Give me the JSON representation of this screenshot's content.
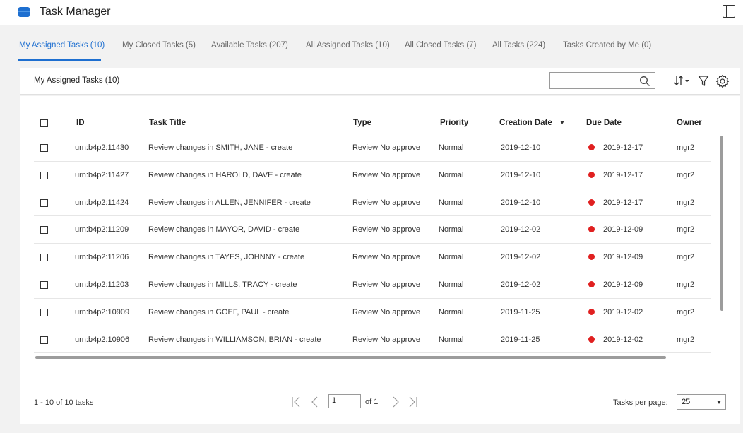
{
  "app": {
    "title": "Task Manager"
  },
  "tabs": [
    {
      "label": "My Assigned Tasks (10)",
      "active": true
    },
    {
      "label": "My Closed Tasks (5)"
    },
    {
      "label": "Available Tasks (207)"
    },
    {
      "label": "All Assigned Tasks (10)"
    },
    {
      "label": "All Closed Tasks (7)"
    },
    {
      "label": "All Tasks (224)"
    },
    {
      "label": "Tasks Created by Me (0)"
    }
  ],
  "list": {
    "title": "My Assigned Tasks (10)",
    "search_value": ""
  },
  "table": {
    "columns": [
      "ID",
      "Task Title",
      "Type",
      "Priority",
      "Creation Date",
      "Due Date",
      "Owner"
    ],
    "sort_column": "Creation Date",
    "rows": [
      {
        "id": "urn:b4p2:11430",
        "title": "Review changes in SMITH, JANE - create",
        "type": "Review No approve",
        "priority": "Normal",
        "created": "2019-12-10",
        "due": "2019-12-17",
        "owner": "mgr2"
      },
      {
        "id": "urn:b4p2:11427",
        "title": "Review changes in HAROLD, DAVE - create",
        "type": "Review No approve",
        "priority": "Normal",
        "created": "2019-12-10",
        "due": "2019-12-17",
        "owner": "mgr2"
      },
      {
        "id": "urn:b4p2:11424",
        "title": "Review changes in ALLEN, JENNIFER - create",
        "type": "Review No approve",
        "priority": "Normal",
        "created": "2019-12-10",
        "due": "2019-12-17",
        "owner": "mgr2"
      },
      {
        "id": "urn:b4p2:11209",
        "title": "Review changes in MAYOR, DAVID - create",
        "type": "Review No approve",
        "priority": "Normal",
        "created": "2019-12-02",
        "due": "2019-12-09",
        "owner": "mgr2"
      },
      {
        "id": "urn:b4p2:11206",
        "title": "Review changes in TAYES, JOHNNY - create",
        "type": "Review No approve",
        "priority": "Normal",
        "created": "2019-12-02",
        "due": "2019-12-09",
        "owner": "mgr2"
      },
      {
        "id": "urn:b4p2:11203",
        "title": "Review changes in MILLS, TRACY - create",
        "type": "Review No approve",
        "priority": "Normal",
        "created": "2019-12-02",
        "due": "2019-12-09",
        "owner": "mgr2"
      },
      {
        "id": "urn:b4p2:10909",
        "title": "Review changes in GOEF, PAUL - create",
        "type": "Review No approve",
        "priority": "Normal",
        "created": "2019-11-25",
        "due": "2019-12-02",
        "owner": "mgr2"
      },
      {
        "id": "urn:b4p2:10906",
        "title": "Review changes in WILLIAMSON, BRIAN - create",
        "type": "Review No approve",
        "priority": "Normal",
        "created": "2019-11-25",
        "due": "2019-12-02",
        "owner": "mgr2"
      }
    ]
  },
  "pagination": {
    "summary": "1 - 10 of 10 tasks",
    "current_page": "1",
    "of_label": "of 1",
    "per_page_label": "Tasks per page:",
    "per_page_value": "25"
  },
  "colors": {
    "accent": "#1e6fd0",
    "overdue": "#e02020",
    "app_icon": "#1e6fd0"
  },
  "icons": [
    "app-icon",
    "panel-toggle-icon",
    "search-icon",
    "sort-icon",
    "filter-icon",
    "settings-icon",
    "first-page-icon",
    "prev-page-icon",
    "next-page-icon",
    "last-page-icon",
    "chevron-down-icon"
  ]
}
